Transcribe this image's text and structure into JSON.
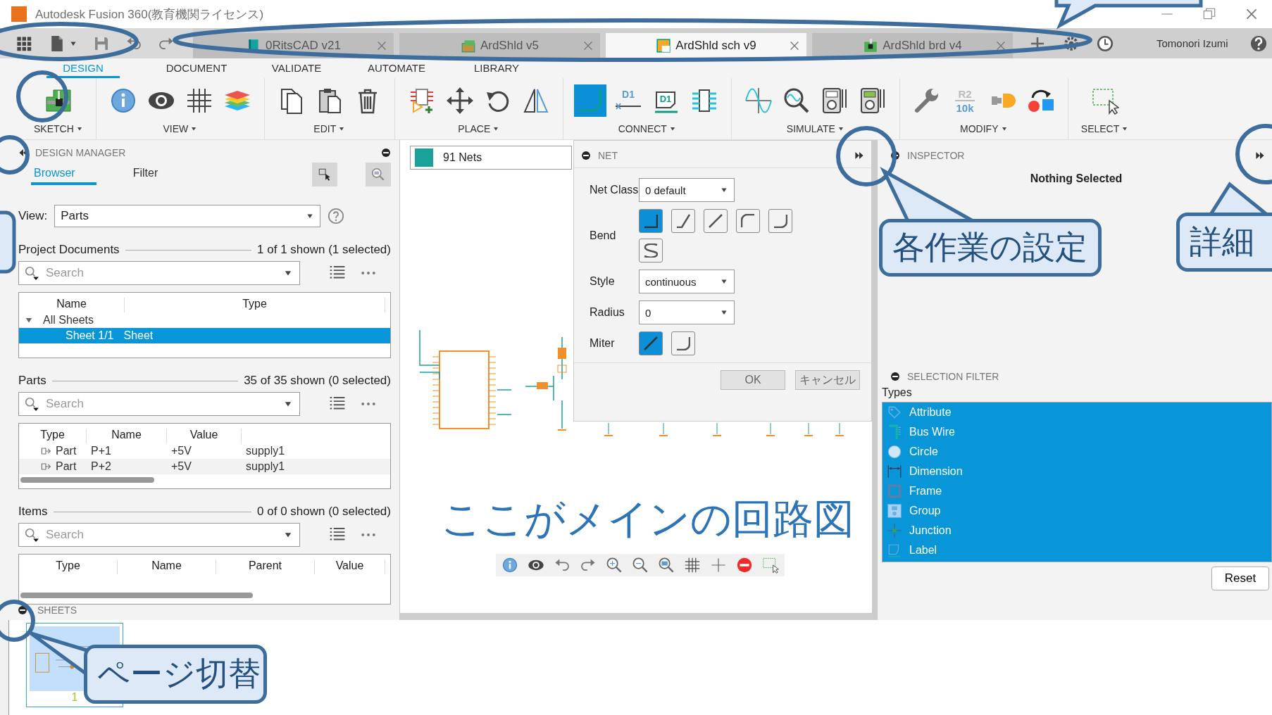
{
  "window": {
    "title": "Autodesk Fusion 360(教育機関ライセンス)"
  },
  "doc_tabs": [
    {
      "label": "0RitsCAD v21",
      "kind": "book",
      "selected": false
    },
    {
      "label": "ArdShld v5",
      "kind": "project",
      "selected": false
    },
    {
      "label": "ArdShld sch v9",
      "kind": "schematic",
      "selected": true
    },
    {
      "label": "ArdShld brd v4",
      "kind": "board",
      "selected": false
    }
  ],
  "user": {
    "name": "Tomonori Izumi"
  },
  "menu_tabs": [
    {
      "label": "DESIGN",
      "selected": true
    },
    {
      "label": "DOCUMENT",
      "selected": false
    },
    {
      "label": "VALIDATE",
      "selected": false
    },
    {
      "label": "AUTOMATE",
      "selected": false
    },
    {
      "label": "LIBRARY",
      "selected": false
    }
  ],
  "toolbar": [
    {
      "label": "SKETCH",
      "tools": [
        {
          "kind": "board",
          "selected": false
        }
      ]
    },
    {
      "label": "VIEW",
      "tools": [
        {
          "kind": "info",
          "selected": false
        },
        {
          "kind": "eye",
          "selected": false
        },
        {
          "kind": "grid",
          "selected": false
        },
        {
          "kind": "layers",
          "selected": false
        }
      ]
    },
    {
      "label": "EDIT",
      "tools": [
        {
          "kind": "copy",
          "selected": false
        },
        {
          "kind": "paste",
          "selected": false
        },
        {
          "kind": "trash",
          "selected": false
        }
      ]
    },
    {
      "label": "PLACE",
      "tools": [
        {
          "kind": "addpart",
          "selected": false
        },
        {
          "kind": "move",
          "selected": false
        },
        {
          "kind": "rotate",
          "selected": false
        },
        {
          "kind": "mirror",
          "selected": false
        }
      ]
    },
    {
      "label": "CONNECT",
      "tools": [
        {
          "kind": "net",
          "selected": true
        },
        {
          "kind": "name",
          "selected": false,
          "texts": [
            "D1"
          ]
        },
        {
          "kind": "label",
          "selected": false,
          "texts": [
            "D1"
          ]
        },
        {
          "kind": "pins",
          "selected": false
        }
      ]
    },
    {
      "label": "SIMULATE",
      "tools": [
        {
          "kind": "wave",
          "selected": false
        },
        {
          "kind": "probe",
          "selected": false
        },
        {
          "kind": "meter",
          "selected": false
        },
        {
          "kind": "meter2",
          "selected": false
        }
      ]
    },
    {
      "label": "MODIFY",
      "tools": [
        {
          "kind": "wrench",
          "selected": false
        },
        {
          "kind": "value",
          "selected": false,
          "texts": [
            "R2",
            "10k"
          ]
        },
        {
          "kind": "gate",
          "selected": false
        },
        {
          "kind": "swap",
          "selected": false
        }
      ]
    },
    {
      "label": "SELECT",
      "tools": [
        {
          "kind": "select",
          "selected": false
        }
      ]
    }
  ],
  "design_manager": {
    "title": "DESIGN MANAGER",
    "tabs": [
      {
        "label": "Browser",
        "selected": true
      },
      {
        "label": "Filter",
        "selected": false
      }
    ],
    "view": {
      "label": "View:",
      "value": "Parts"
    },
    "sections": [
      {
        "title": "Project Documents",
        "count": "1 of 1 shown (1 selected)",
        "search": {
          "placeholder": "Search"
        },
        "columns": [
          "Name",
          "Type"
        ],
        "rows": [
          {
            "cells": [
              "All Sheets"
            ],
            "expanded": true,
            "selected": false,
            "children": [
              {
                "cells": [
                  "Sheet 1/1",
                  "Sheet"
                ],
                "selected": true
              }
            ]
          }
        ]
      },
      {
        "title": "Parts",
        "count": "35 of 35 shown (0 selected)",
        "search": {
          "placeholder": "Search"
        },
        "columns": [
          "Type",
          "Name",
          "Value"
        ],
        "rows": [
          {
            "cells": [
              "Part",
              "P+1",
              "+5V",
              "supply1"
            ],
            "selected": false
          },
          {
            "cells": [
              "Part",
              "P+2",
              "+5V",
              "supply1"
            ],
            "selected": false
          }
        ]
      },
      {
        "title": "Items",
        "count": "0 of 0 shown (0 selected)",
        "search": {
          "placeholder": "Search"
        },
        "columns": [
          "Type",
          "Name",
          "Parent",
          "Value"
        ]
      }
    ]
  },
  "canvas": {
    "nets": {
      "label": "91 Nets"
    },
    "caption": "ここがメインの回路図"
  },
  "net_panel": {
    "title": "NET",
    "net_class": {
      "label": "Net Class",
      "value": "0 default"
    },
    "bend": {
      "label": "Bend",
      "options": [
        {
          "kind": "corner",
          "selected": true
        },
        {
          "kind": "angle45",
          "selected": false
        },
        {
          "kind": "straight",
          "selected": false
        },
        {
          "kind": "arc",
          "selected": false
        },
        {
          "kind": "round",
          "selected": false
        },
        {
          "kind": "spline",
          "selected": false
        }
      ]
    },
    "style": {
      "label": "Style",
      "value": "continuous"
    },
    "radius": {
      "label": "Radius",
      "value": "0"
    },
    "miter": {
      "label": "Miter",
      "options": [
        {
          "kind": "straight",
          "selected": true
        },
        {
          "kind": "round",
          "selected": false
        }
      ]
    },
    "buttons": [
      "OK",
      "キャンセル"
    ]
  },
  "inspector": {
    "title": "INSPECTOR",
    "message": "Nothing Selected"
  },
  "selection_filter": {
    "title": "SELECTION FILTER",
    "heading": "Types",
    "items": [
      {
        "label": "Attribute",
        "kind": "attribute",
        "selected": true
      },
      {
        "label": "Bus Wire",
        "kind": "bus",
        "selected": true
      },
      {
        "label": "Circle",
        "kind": "circle",
        "selected": true
      },
      {
        "label": "Dimension",
        "kind": "dimension",
        "selected": true
      },
      {
        "label": "Frame",
        "kind": "frame",
        "selected": true
      },
      {
        "label": "Group",
        "kind": "group",
        "selected": true
      },
      {
        "label": "Junction",
        "kind": "junction",
        "selected": true
      },
      {
        "label": "Label",
        "kind": "label",
        "selected": true
      }
    ],
    "reset": "Reset"
  },
  "sheets": {
    "title": "SHEETS",
    "pages": [
      {
        "label": "1",
        "selected": true
      }
    ]
  },
  "annotations": [
    {
      "text": "各作業の設定"
    },
    {
      "text": "詳細"
    },
    {
      "text": "ページ切替"
    }
  ]
}
